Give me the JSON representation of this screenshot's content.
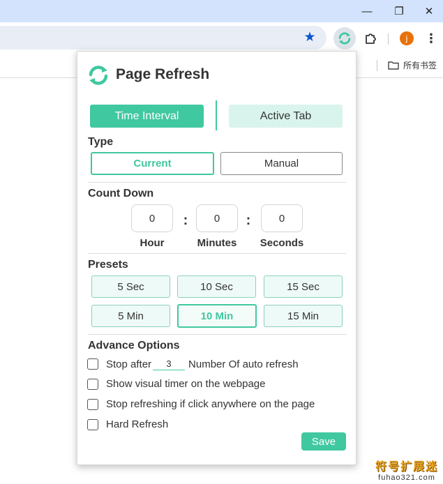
{
  "browser": {
    "window_controls": {
      "minimize": "—",
      "restore": "❐",
      "close": "✕"
    },
    "bookmark_folder": "所有书签",
    "avatar_letter": "j",
    "icons": [
      "bookmark-star-icon",
      "page-refresh-extension-icon",
      "extensions-puzzle-icon",
      "more-menu-icon",
      "folder-icon"
    ]
  },
  "popup": {
    "title": "Page Refresh",
    "tabs": [
      {
        "label": "Time Interval",
        "active": true
      },
      {
        "label": "Active Tab",
        "active": false
      }
    ],
    "type": {
      "heading": "Type",
      "options": [
        {
          "label": "Current",
          "selected": true
        },
        {
          "label": "Manual",
          "selected": false
        }
      ]
    },
    "countdown": {
      "heading": "Count Down",
      "hour": "0",
      "minutes": "0",
      "seconds": "0",
      "labels": {
        "hour": "Hour",
        "minutes": "Minutes",
        "seconds": "Seconds"
      },
      "separator": ":"
    },
    "presets": {
      "heading": "Presets",
      "items": [
        {
          "label": "5 Sec",
          "selected": false
        },
        {
          "label": "10 Sec",
          "selected": false
        },
        {
          "label": "15 Sec",
          "selected": false
        },
        {
          "label": "5 Min",
          "selected": false
        },
        {
          "label": "10 Min",
          "selected": true
        },
        {
          "label": "15 Min",
          "selected": false
        }
      ]
    },
    "advanced": {
      "heading": "Advance Options",
      "stop_after_prefix": "Stop after",
      "stop_after_value": "3",
      "stop_after_suffix": "Number Of auto refresh",
      "visual_timer": "Show visual timer on the webpage",
      "stop_on_click": "Stop refreshing if click anywhere on the page",
      "hard_refresh": "Hard Refresh"
    },
    "save_label": "Save"
  },
  "watermark": {
    "line1": "符号扩展迷",
    "line2": "fuhao321.com"
  },
  "colors": {
    "accent": "#40c8a0",
    "accent_light": "#d9f4ec",
    "titlebar": "#d3e3fd",
    "avatar": "#e8710a"
  }
}
